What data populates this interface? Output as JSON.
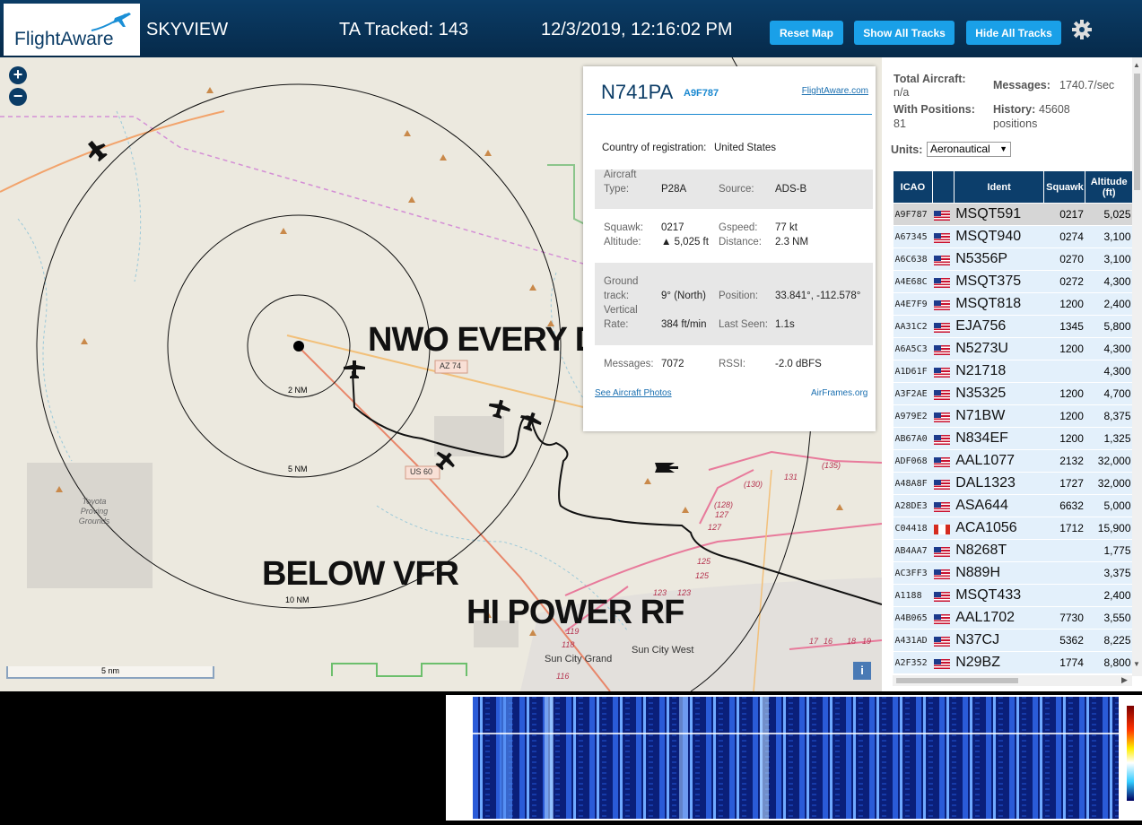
{
  "header": {
    "logo_text": "FlightAware",
    "app_title": "SKYVIEW",
    "ta_tracked": "TA Tracked: 143",
    "datetime": "12/3/2019, 12:16:02 PM",
    "buttons": {
      "reset": "Reset Map",
      "show": "Show All Tracks",
      "hide": "Hide All Tracks"
    }
  },
  "map": {
    "overlays": [
      "NWO EVERY DAY",
      "BELOW VFR",
      "HI POWER RF"
    ],
    "ring_labels": [
      "2 NM",
      "5 NM",
      "10 NM"
    ],
    "roads": [
      "AZ 74",
      "US 60"
    ],
    "places": [
      "Toyota Proving Grounds",
      "Sun City West",
      "Sun City Grand"
    ],
    "route_numbers": [
      "(135)",
      "131",
      "(130)",
      "(128)",
      "127",
      "127",
      "125",
      "125",
      "123",
      "123",
      "119",
      "118",
      "116",
      "17",
      "16",
      "18",
      "19"
    ],
    "scale": "5 nm",
    "zoom_in": "+",
    "zoom_out": "−",
    "info_btn": "i"
  },
  "popup": {
    "callsign": "N741PA",
    "hex": "A9F787",
    "fa_link": "FlightAware.com",
    "country_label": "Country of registration:",
    "country": "United States",
    "aircraft_type_label1": "Aircraft",
    "aircraft_type_label2": "Type:",
    "aircraft_type": "P28A",
    "source_label": "Source:",
    "source": "ADS-B",
    "squawk_label": "Squawk:",
    "squawk": "0217",
    "gspeed_label": "Gspeed:",
    "gspeed": "77 kt",
    "altitude_label": "Altitude:",
    "altitude": "▲ 5,025 ft",
    "distance_label": "Distance:",
    "distance": "2.3 NM",
    "ground_label1": "Ground",
    "ground_label2": "track:",
    "ground_track": "9° (North)",
    "position_label": "Position:",
    "position": "33.841°, -112.578°",
    "vrate_label1": "Vertical",
    "vrate_label2": "Rate:",
    "vrate": "384 ft/min",
    "lastseen_label": "Last Seen:",
    "lastseen": "1.1s",
    "messages_label": "Messages:",
    "messages": "7072",
    "rssi_label": "RSSI:",
    "rssi": "-2.0 dBFS",
    "photos_link": "See Aircraft Photos",
    "airframes_link": "AirFrames.org"
  },
  "sidebar": {
    "total_label": "Total Aircraft:",
    "total": "n/a",
    "messages_label": "Messages:",
    "messages": "1740.7/sec",
    "withpos_label": "With Positions:",
    "withpos": "81",
    "history_label": "History:",
    "history": "45608",
    "history_unit": "positions",
    "units_label": "Units:",
    "units": "Aeronautical",
    "columns": [
      "ICAO",
      "",
      "Ident",
      "Squawk",
      "Altitude (ft)"
    ],
    "rows": [
      {
        "icao": "A9F787",
        "flag": "us",
        "ident": "MSQT591",
        "squawk": "0217",
        "alt": "5,025"
      },
      {
        "icao": "A67345",
        "flag": "us",
        "ident": "MSQT940",
        "squawk": "0274",
        "alt": "3,100"
      },
      {
        "icao": "A6C638",
        "flag": "us",
        "ident": "N5356P",
        "squawk": "0270",
        "alt": "3,100"
      },
      {
        "icao": "A4E68C",
        "flag": "us",
        "ident": "MSQT375",
        "squawk": "0272",
        "alt": "4,300"
      },
      {
        "icao": "A4E7F9",
        "flag": "us",
        "ident": "MSQT818",
        "squawk": "1200",
        "alt": "2,400"
      },
      {
        "icao": "AA31C2",
        "flag": "us",
        "ident": "EJA756",
        "squawk": "1345",
        "alt": "5,800"
      },
      {
        "icao": "A6A5C3",
        "flag": "us",
        "ident": "N5273U",
        "squawk": "1200",
        "alt": "4,300"
      },
      {
        "icao": "A1D61F",
        "flag": "us",
        "ident": "N21718",
        "squawk": "",
        "alt": "4,300"
      },
      {
        "icao": "A3F2AE",
        "flag": "us",
        "ident": "N35325",
        "squawk": "1200",
        "alt": "4,700"
      },
      {
        "icao": "A979E2",
        "flag": "us",
        "ident": "N71BW",
        "squawk": "1200",
        "alt": "8,375"
      },
      {
        "icao": "AB67A0",
        "flag": "us",
        "ident": "N834EF",
        "squawk": "1200",
        "alt": "1,325"
      },
      {
        "icao": "ADF068",
        "flag": "us",
        "ident": "AAL1077",
        "squawk": "2132",
        "alt": "32,000"
      },
      {
        "icao": "A48A8F",
        "flag": "us",
        "ident": "DAL1323",
        "squawk": "1727",
        "alt": "32,000"
      },
      {
        "icao": "A28DE3",
        "flag": "us",
        "ident": "ASA644",
        "squawk": "6632",
        "alt": "5,000"
      },
      {
        "icao": "C04418",
        "flag": "ca",
        "ident": "ACA1056",
        "squawk": "1712",
        "alt": "15,900"
      },
      {
        "icao": "AB4AA7",
        "flag": "us",
        "ident": "N8268T",
        "squawk": "",
        "alt": "1,775"
      },
      {
        "icao": "AC3FF3",
        "flag": "us",
        "ident": "N889H",
        "squawk": "",
        "alt": "3,375"
      },
      {
        "icao": "A1188",
        "flag": "us",
        "ident": "MSQT433",
        "squawk": "",
        "alt": "2,400"
      },
      {
        "icao": "A4B065",
        "flag": "us",
        "ident": "AAL1702",
        "squawk": "7730",
        "alt": "3,550"
      },
      {
        "icao": "A431AD",
        "flag": "us",
        "ident": "N37CJ",
        "squawk": "5362",
        "alt": "8,225"
      },
      {
        "icao": "A2F352",
        "flag": "us",
        "ident": "N29BZ",
        "squawk": "1774",
        "alt": "8,800"
      }
    ]
  },
  "colors": {
    "header": "#0b3c66",
    "button": "#1aa0e8",
    "table_header": "#0c3e6b",
    "row_bg": "#e3f0fb"
  }
}
